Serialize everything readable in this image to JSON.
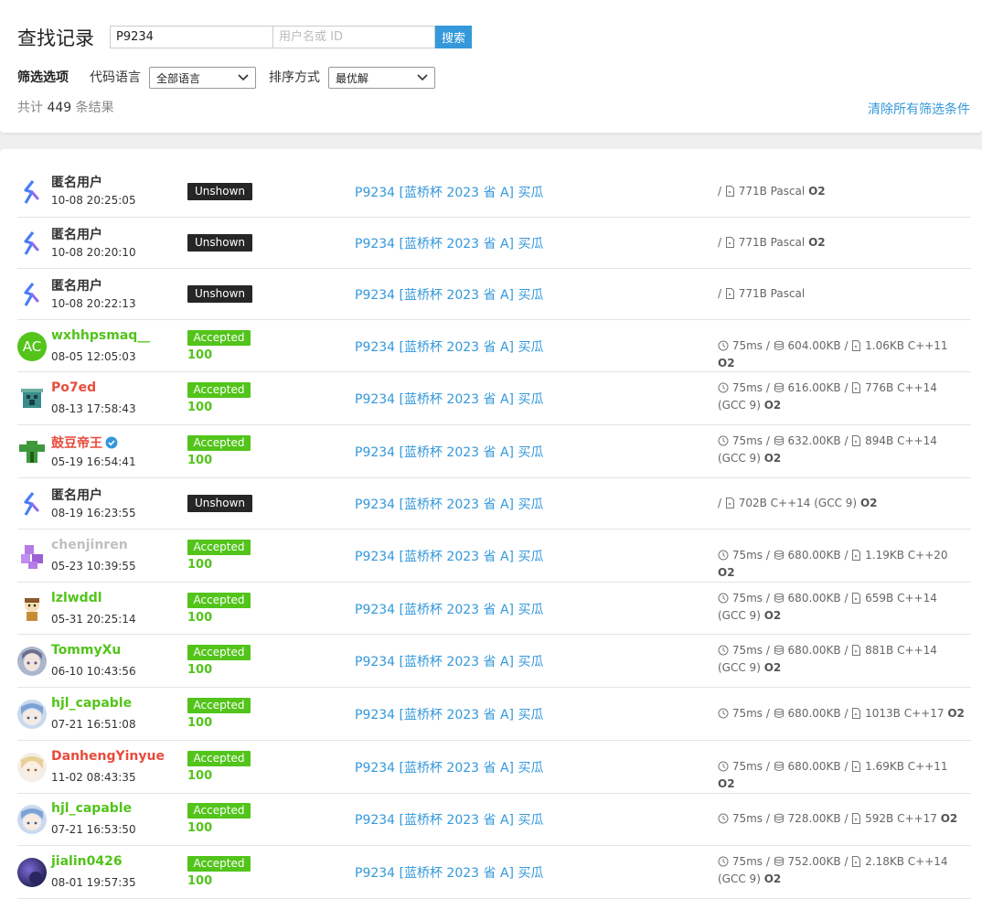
{
  "header": {
    "title": "查找记录",
    "problem_query": "P9234",
    "user_placeholder": "用户名或 ID",
    "search_label": "搜索"
  },
  "filters": {
    "label": "筛选选项",
    "language_label": "代码语言",
    "language_value": "全部语言",
    "sort_label": "排序方式",
    "sort_value": "最优解",
    "clear_label": "清除所有筛选条件"
  },
  "summary": {
    "prefix": "共计",
    "count": "449",
    "suffix": "条结果"
  },
  "colors": {
    "accent": "#3498db",
    "accepted": "#52c41a",
    "unshown": "#262626",
    "name_green": "#52c41a",
    "name_red": "#e74c3c",
    "name_gray": "#bfbfbf"
  },
  "records": [
    {
      "user": "匿名用户",
      "user_color": "#333333",
      "avatar": "luogu-logo-icon",
      "time": "10-08 20:25:05",
      "status": "Unshown",
      "score": "",
      "problem": "P9234 [蓝桥杯 2023 省 A] 买瓜",
      "time_used": "",
      "memory": "",
      "size": "771B",
      "lang": "Pascal",
      "o2": "O2",
      "verified": false
    },
    {
      "user": "匿名用户",
      "user_color": "#333333",
      "avatar": "luogu-logo-icon",
      "time": "10-08 20:20:10",
      "status": "Unshown",
      "score": "",
      "problem": "P9234 [蓝桥杯 2023 省 A] 买瓜",
      "time_used": "",
      "memory": "",
      "size": "771B",
      "lang": "Pascal",
      "o2": "O2",
      "verified": false
    },
    {
      "user": "匿名用户",
      "user_color": "#333333",
      "avatar": "luogu-logo-icon",
      "time": "10-08 20:22:13",
      "status": "Unshown",
      "score": "",
      "problem": "P9234 [蓝桥杯 2023 省 A] 买瓜",
      "time_used": "",
      "memory": "",
      "size": "771B",
      "lang": "Pascal",
      "o2": "",
      "verified": false
    },
    {
      "user": "wxhhpsmaq__",
      "user_color": "#52c41a",
      "avatar": "initials-avatar",
      "avatar_text": "AC",
      "time": "08-05 12:05:03",
      "status": "Accepted",
      "score": "100",
      "problem": "P9234 [蓝桥杯 2023 省 A] 买瓜",
      "time_used": "75ms",
      "memory": "604.00KB",
      "size": "1.06KB",
      "lang": "C++11",
      "o2": "O2",
      "verified": false
    },
    {
      "user": "Po7ed",
      "user_color": "#e74c3c",
      "avatar": "pixel-creeper-avatar",
      "time": "08-13 17:58:43",
      "status": "Accepted",
      "score": "100",
      "problem": "P9234 [蓝桥杯 2023 省 A] 买瓜",
      "time_used": "75ms",
      "memory": "616.00KB",
      "size": "776B",
      "lang": "C++14 (GCC 9)",
      "o2": "O2",
      "verified": false
    },
    {
      "user": "鼓豆帝王",
      "user_color": "#e74c3c",
      "avatar": "green-pixel-avatar",
      "time": "05-19 16:54:41",
      "status": "Accepted",
      "score": "100",
      "problem": "P9234 [蓝桥杯 2023 省 A] 买瓜",
      "time_used": "75ms",
      "memory": "632.00KB",
      "size": "894B",
      "lang": "C++14 (GCC 9)",
      "o2": "O2",
      "verified": true
    },
    {
      "user": "匿名用户",
      "user_color": "#333333",
      "avatar": "luogu-logo-icon",
      "time": "08-19 16:23:55",
      "status": "Unshown",
      "score": "",
      "problem": "P9234 [蓝桥杯 2023 省 A] 买瓜",
      "time_used": "",
      "memory": "",
      "size": "702B",
      "lang": "C++14 (GCC 9)",
      "o2": "O2",
      "verified": false
    },
    {
      "user": "chenjinren",
      "user_color": "#bfbfbf",
      "avatar": "purple-pixel-avatar",
      "time": "05-23 10:39:55",
      "status": "Accepted",
      "score": "100",
      "problem": "P9234 [蓝桥杯 2023 省 A] 买瓜",
      "time_used": "75ms",
      "memory": "680.00KB",
      "size": "1.19KB",
      "lang": "C++20",
      "o2": "O2",
      "verified": false
    },
    {
      "user": "lzlwddl",
      "user_color": "#52c41a",
      "avatar": "character-avatar",
      "time": "05-31 20:25:14",
      "status": "Accepted",
      "score": "100",
      "problem": "P9234 [蓝桥杯 2023 省 A] 买瓜",
      "time_used": "75ms",
      "memory": "680.00KB",
      "size": "659B",
      "lang": "C++14 (GCC 9)",
      "o2": "O2",
      "verified": false
    },
    {
      "user": "TommyXu",
      "user_color": "#52c41a",
      "avatar": "anime-avatar",
      "time": "06-10 10:43:56",
      "status": "Accepted",
      "score": "100",
      "problem": "P9234 [蓝桥杯 2023 省 A] 买瓜",
      "time_used": "75ms",
      "memory": "680.00KB",
      "size": "881B",
      "lang": "C++14 (GCC 9)",
      "o2": "O2",
      "verified": false
    },
    {
      "user": "hjl_capable",
      "user_color": "#52c41a",
      "avatar": "anime-avatar-blue",
      "time": "07-21 16:51:08",
      "status": "Accepted",
      "score": "100",
      "problem": "P9234 [蓝桥杯 2023 省 A] 买瓜",
      "time_used": "75ms",
      "memory": "680.00KB",
      "size": "1013B",
      "lang": "C++17",
      "o2": "O2",
      "verified": false
    },
    {
      "user": "DanhengYinyue",
      "user_color": "#e74c3c",
      "avatar": "anime-avatar-blonde",
      "time": "11-02 08:43:35",
      "status": "Accepted",
      "score": "100",
      "problem": "P9234 [蓝桥杯 2023 省 A] 买瓜",
      "time_used": "75ms",
      "memory": "680.00KB",
      "size": "1.69KB",
      "lang": "C++11",
      "o2": "O2",
      "verified": false
    },
    {
      "user": "hjl_capable",
      "user_color": "#52c41a",
      "avatar": "anime-avatar-blue",
      "time": "07-21 16:53:50",
      "status": "Accepted",
      "score": "100",
      "problem": "P9234 [蓝桥杯 2023 省 A] 买瓜",
      "time_used": "75ms",
      "memory": "728.00KB",
      "size": "592B",
      "lang": "C++17",
      "o2": "O2",
      "verified": false
    },
    {
      "user": "jialin0426",
      "user_color": "#52c41a",
      "avatar": "night-sky-avatar",
      "time": "08-01 19:57:35",
      "status": "Accepted",
      "score": "100",
      "problem": "P9234 [蓝桥杯 2023 省 A] 买瓜",
      "time_used": "75ms",
      "memory": "752.00KB",
      "size": "2.18KB",
      "lang": "C++14 (GCC 9)",
      "o2": "O2",
      "verified": false
    }
  ]
}
